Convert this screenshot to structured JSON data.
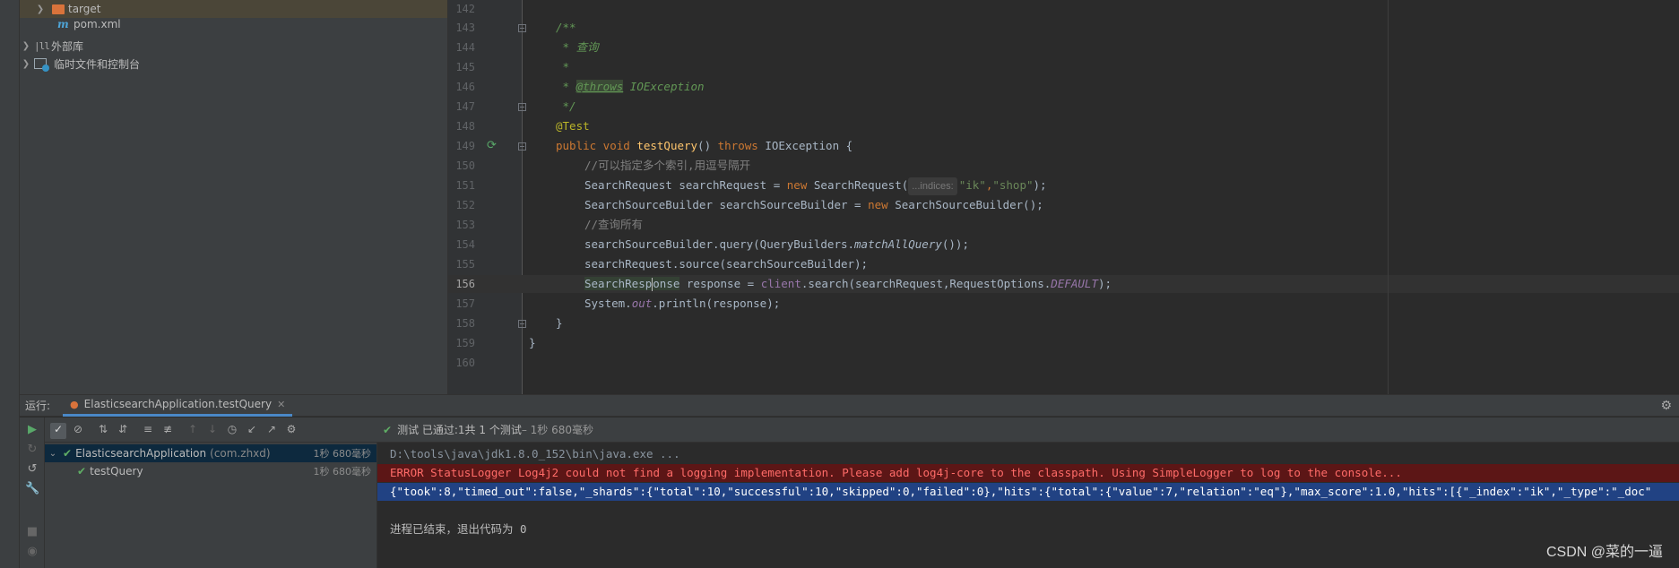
{
  "project_tree": {
    "items": [
      {
        "label": "target",
        "icon": "folder-icon"
      },
      {
        "label": "pom.xml",
        "icon": "maven-file-icon"
      },
      {
        "label": "外部库",
        "icon": "library-icon"
      },
      {
        "label": "临时文件和控制台",
        "icon": "scratches-icon"
      }
    ]
  },
  "editor": {
    "line_numbers": [
      "142",
      "143",
      "144",
      "145",
      "146",
      "147",
      "148",
      "149",
      "150",
      "151",
      "152",
      "153",
      "154",
      "155",
      "156",
      "157",
      "158",
      "159",
      "160"
    ],
    "active_line": "156",
    "code": {
      "l143": "/**",
      "l144": " * 查询",
      "l145": " *",
      "l146_star": " * ",
      "l146_tag": "@throws",
      "l146_rest": " IOException",
      "l147": " */",
      "l148": "@Test",
      "l149_kw1": "public void ",
      "l149_fn": "testQuery",
      "l149_mid": "() ",
      "l149_kw2": "throws ",
      "l149_rest": "IOException {",
      "l150": "//可以指定多个索引,用逗号隔开",
      "l151_a": "SearchRequest searchRequest = ",
      "l151_new": "new ",
      "l151_b": "SearchRequest(",
      "l151_hint": "...indices:",
      "l151_s1": "\"ik\"",
      "l151_c": ",",
      "l151_s2": "\"shop\"",
      "l151_d": ");",
      "l152_a": "SearchSourceBuilder searchSourceBuilder = ",
      "l152_new": "new ",
      "l152_b": "SearchSourceBuilder();",
      "l153": "//查询所有",
      "l154_a": "searchSourceBuilder.query(QueryBuilders.",
      "l154_it": "matchAllQuery",
      "l154_b": "());",
      "l155": "searchRequest.source(searchSourceBuilder);",
      "l156_a": "SearchResp",
      "l156_b": "onse",
      "l156_c": " response = ",
      "l156_field": "client",
      "l156_d": ".search(searchRequest,RequestOptions.",
      "l156_const": "DEFAULT",
      "l156_e": ");",
      "l157_a": "System.",
      "l157_out": "out",
      "l157_b": ".println(response);",
      "l158": "}",
      "l159": "}"
    }
  },
  "run_panel": {
    "label": "运行:",
    "tab_label": "ElasticsearchApplication.testQuery",
    "status": {
      "prefix": "测试 已通过: ",
      "count": "1共 1 个测试",
      "time": " – 1秒 680毫秒"
    },
    "tree": [
      {
        "label": "ElasticsearchApplication",
        "pkg": "(com.zhxd)",
        "time": "1秒 680毫秒"
      },
      {
        "label": "testQuery",
        "time": "1秒 680毫秒"
      }
    ],
    "console": {
      "cmd": "D:\\tools\\java\\jdk1.8.0_152\\bin\\java.exe ...",
      "error": "ERROR StatusLogger Log4j2 could not find a logging implementation. Please add log4j-core to the classpath. Using SimpleLogger to log to the console...",
      "output": "{\"took\":8,\"timed_out\":false,\"_shards\":{\"total\":10,\"successful\":10,\"skipped\":0,\"failed\":0},\"hits\":{\"total\":{\"value\":7,\"relation\":\"eq\"},\"max_score\":1.0,\"hits\":[{\"_index\":\"ik\",\"_type\":\"_doc\"",
      "exit": "进程已结束，退出代码为 0"
    }
  },
  "watermark": "CSDN @菜的一逼"
}
